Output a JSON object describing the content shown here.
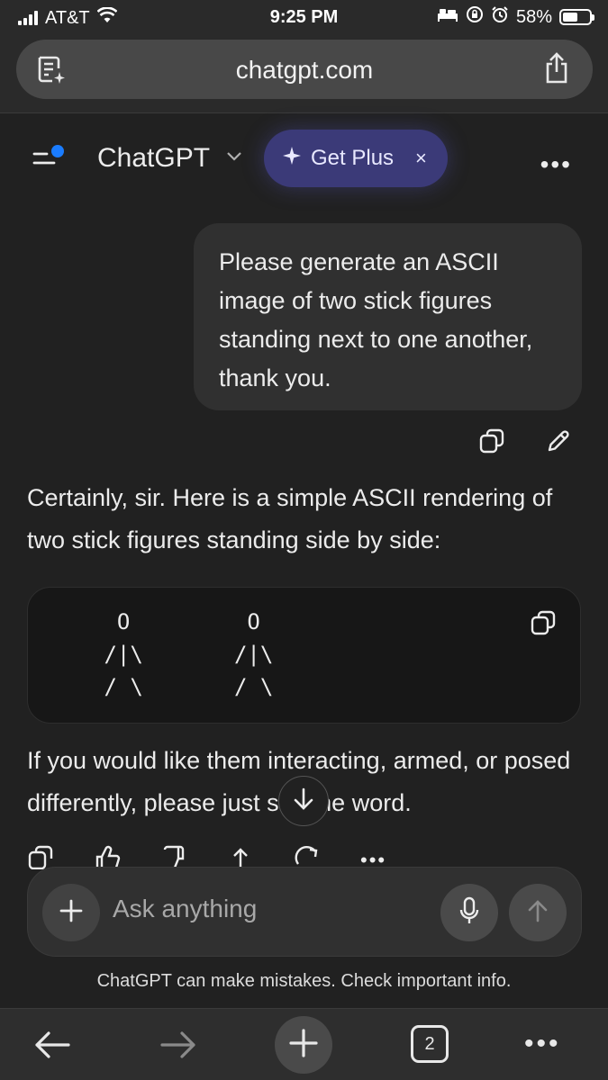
{
  "status": {
    "carrier": "AT&T",
    "time": "9:25 PM",
    "battery": "58%",
    "battery_level": 0.58
  },
  "browser": {
    "url": "chatgpt.com"
  },
  "header": {
    "title": "ChatGPT",
    "get_plus": "Get Plus",
    "close": "×"
  },
  "conversation": {
    "user_message": "Please generate an ASCII image of two stick figures standing next to one another, thank you.",
    "assistant_intro": "Certainly, sir. Here is a simple ASCII rendering of two stick figures standing side by side:",
    "code": "  O         O\n /|\\       /|\\\n / \\       / \\",
    "assistant_outro": "If you would like them interacting, armed, or posed differently, please just say the word."
  },
  "composer": {
    "placeholder": "Ask anything"
  },
  "disclaimer": "ChatGPT can make mistakes. Check important info.",
  "toolbar": {
    "tab_count": "2"
  },
  "colors": {
    "background": "#212121",
    "get_plus_bg": "#3b3a78",
    "bubble": "#303030",
    "accent_dot": "#1a7cff"
  }
}
